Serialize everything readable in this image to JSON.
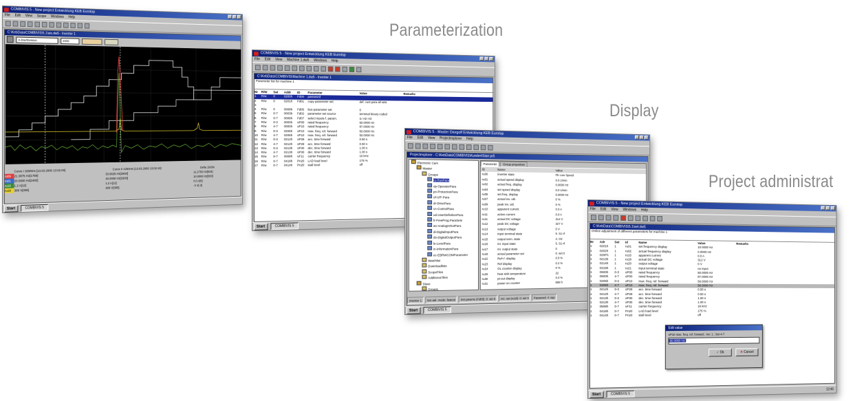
{
  "captions": {
    "parameterization": "Parameterization",
    "display": "Display",
    "project_admin": "Project administrat"
  },
  "scope_window": {
    "title": "COMBIVIS 5 - New project      Entwicklung KEB Eurotop",
    "menus": [
      "File",
      "Edit",
      "View",
      "Scope",
      "Windows",
      "Help"
    ],
    "subtitle": "C:\\KebData\\COMBIVIS\\5.1\\ais.dw5 - Inverter 1",
    "dropdown": "X-line/Division",
    "dropdown2": "2000",
    "status": {
      "curve1": "Curve I 3290ms [13.03.2000 13:02:00]",
      "curve2": "Curve II 4250ms [13.03.2000 13:02:10]",
      "delta": "Delta 1920s",
      "rows": [
        {
          "name": "ru09",
          "a": "21.3875 Hz[1759]",
          "b": "33.6625 Hz[2693]",
          "c": "11.2750 Hz[534]"
        },
        {
          "name": "ru01",
          "a": "20.0000 Hz[2400]",
          "b": "40.0000 Hz[3300]",
          "c": "10.0000 Hz[500]"
        },
        {
          "name": "ru15",
          "a": "1.2 A[12]",
          "b": "1.2 A[12]",
          "c": "0.0 A[0]"
        },
        {
          "name": "ru18",
          "a": "308 V[308]",
          "b": "308 V[385]",
          "c": "-3 V[-3]"
        }
      ]
    },
    "taskbar": {
      "start": "Start",
      "item": "COMBIVIS 5"
    }
  },
  "param_window": {
    "title": "COMBIVIS 5 - New project      Entwicklung KEB Eurotop",
    "menus": [
      "File",
      "Edit",
      "View",
      "Machine 1.dw5",
      "Windows",
      "Help"
    ],
    "subtitle": "C:\\KebData\\COMBIVIS\\Machine 1.dw5 - Inverter 1",
    "desc": "Parameter list for machine 1",
    "headers": [
      "Nr",
      "R/W",
      "Set",
      "Addr",
      "ID",
      "Parameter",
      "Value",
      "Remarks"
    ],
    "rows": [
      [
        "1",
        "R/w",
        "0",
        "0200h",
        "Fd00",
        "password",
        ""
      ],
      [
        "2",
        "R/w",
        "0",
        "0201h",
        "Fd01",
        "copy parameter set",
        "def. cust para all sets"
      ],
      [
        "3",
        "",
        "",
        "",
        "",
        "",
        ""
      ],
      [
        "4",
        "R/w",
        "0",
        "0008h",
        "Fd05",
        "bus parameter set",
        "0"
      ],
      [
        "5",
        "R/w",
        "0-7",
        "0003h",
        "Fd02",
        "parameter set source",
        "terminal binary coded"
      ],
      [
        "6",
        "R/w",
        "0-7",
        "0006h",
        "Fd07",
        "select inputs f. param.",
        "i1->i2->i3"
      ],
      [
        "7",
        "R/w",
        "0-3",
        "0000h",
        "oP00",
        "rated frequency",
        "50.0000 Hz"
      ],
      [
        "8",
        "R/w",
        "4-7",
        "0000h",
        "oP10",
        "rated frequency",
        "87.0000 Hz"
      ],
      [
        "9",
        "R/w",
        "0-3",
        "0206h",
        "oP10",
        "max. freq. ref. forward",
        "50.0000 Hz"
      ],
      [
        "10",
        "R/w",
        "4-7",
        "0206h",
        "oP10",
        "max. freq. ref. forward",
        "50.0000 Hz"
      ],
      [
        "11",
        "R/w",
        "0-3",
        "0212h",
        "oP28",
        "acc. time forward",
        "0.50 s"
      ],
      [
        "12",
        "R/w",
        "4-7",
        "0212h",
        "oP28",
        "acc. time forward",
        "0.50 s"
      ],
      [
        "13",
        "R/w",
        "0-3",
        "0213h",
        "oP30",
        "dec. time forward",
        "1.00 s"
      ],
      [
        "14",
        "R/w",
        "4-7",
        "0213h",
        "oP30",
        "dec. time forward",
        "1.00 s"
      ],
      [
        "15",
        "R/w",
        "0-7",
        "0008h",
        "uF11",
        "carrier frequency",
        "16 kHz"
      ],
      [
        "16",
        "R/w",
        "0-7",
        "0418h",
        "Pn20",
        "LAD load level",
        "175 %"
      ],
      [
        "17",
        "R/w",
        "0-7",
        "0414h",
        "Pn20",
        "stall level",
        "off"
      ]
    ],
    "taskbar": {
      "start": "Start",
      "item": "COMBIVIS 5"
    }
  },
  "display_window": {
    "title": "COMBIVIS 5 - Master Diorgolf      Entwicklung KEB Eurotop",
    "menus": [
      "File",
      "Edit",
      "View",
      "Projectexplorer",
      "Help"
    ],
    "subtitle": "Projectexplorer - C:\\KebData\\COMBIVIS\\Kunden\\Starr.pr5",
    "tree": [
      "Electronic Cam",
      "Master",
      "Groups",
      "ru-RunPara",
      "op-OperatorPara",
      "pn-ProtectionPara",
      "uf-U/F-Para",
      "dr-DrivePara",
      "cn-ControlPara",
      "ud-UserDefinitionPara",
      "fr-FreeProg.ParaSets",
      "an-AnalogInOutPara",
      "di-DigitalInputPara",
      "do-DigitalOutputPara",
      "le-LevelPara",
      "in-InformationPara",
      "ec-EBRWCOMParameter",
      "Watchlist",
      "Downloadlists",
      "ScopeFiles",
      "Additional files",
      "Slave",
      "Groups",
      "Watchlist",
      "Downloadlists",
      "ScopeFiles"
    ],
    "tabs": [
      "Parameter",
      "Group properties"
    ],
    "headers": [
      "ID",
      "Name",
      "Value"
    ],
    "rows": [
      [
        "ru00",
        "inverter state",
        "Fb Low Speed"
      ],
      [
        "ru01",
        "actual speed display",
        "0.0 1/min"
      ],
      [
        "ru02",
        "actual freq. display",
        "0.0000 Hz"
      ],
      [
        "ru04",
        "set speed display",
        "0.0 1/min"
      ],
      [
        "ru05",
        "set freq. display",
        "0.0000 Hz"
      ],
      [
        "ru07",
        "actual inv. util.",
        "0 %"
      ],
      [
        "ru09",
        "peak inv. util.",
        "0 %"
      ],
      [
        "ru10",
        "apparent current",
        "0.0 A"
      ],
      [
        "ru11",
        "active current",
        "0.0 A"
      ],
      [
        "ru11",
        "actual DC voltage",
        "314 V"
      ],
      [
        "ru12",
        "peak DC voltage",
        "327 V"
      ],
      [
        "ru13",
        "output voltage",
        "0 V"
      ],
      [
        "ru14",
        "input terminal state",
        "5. S1-rf"
      ],
      [
        "ru15",
        "output term. state",
        "2. O2"
      ],
      [
        "ru16",
        "int. input state",
        "5. S1-rf"
      ],
      [
        "ru17",
        "int. output state",
        "0"
      ],
      [
        "ru18",
        "actual parameter set",
        "0. set 0"
      ],
      [
        "ru22",
        "Ref+/- display",
        "0.0 %"
      ],
      [
        "ru23",
        "Ref display",
        "0.2 %"
      ],
      [
        "ru24",
        "OL counter display",
        "0 %"
      ],
      [
        "ru26",
        "heat sink temperature",
        "22"
      ],
      [
        "ru30",
        "pt-out display",
        "0.0 %"
      ],
      [
        "ru31",
        "power on counter",
        "568 h"
      ]
    ],
    "statusbar": [
      "Inverter 1",
      "Set adr. mode: fastest",
      "Set params (Fd05): 0: set 0",
      "Act. set (ru18): 0: set 0",
      "Password: 4: sup"
    ],
    "taskbar": {
      "start": "Start",
      "item": "COMBIVIS 5"
    }
  },
  "admin_window": {
    "title": "COMBIVIS 5 - New project      Entwicklung KEB Eurotop",
    "menus": [
      "File",
      "Edit",
      "View",
      "Windows",
      "Help"
    ],
    "subtitle": "C:\\KebData\\COMBIVIS\\5.1\\set.dw5",
    "desc": "Online adjustment of different parameters for machine 1",
    "headers": [
      "Nr",
      "Adr",
      "Set",
      "Id",
      "Name",
      "Value",
      "Remarks"
    ],
    "rows": [
      [
        "1",
        "0201h",
        "1",
        "ru01",
        "set frequency display",
        "10.0000 Hz"
      ],
      [
        "1",
        "0202h",
        "1",
        "ru02",
        "actual frequency display",
        "0.0000 Hz"
      ],
      [
        "1",
        "020Fh",
        "1",
        "ru15",
        "apparent current",
        "0.0 A"
      ],
      [
        "1",
        "0213h",
        "1",
        "ru18",
        "actual DC voltage",
        "312 V"
      ],
      [
        "1",
        "0214h",
        "1",
        "ru20",
        "output voltage",
        "0 V"
      ],
      [
        "1",
        "0219h",
        "1",
        "ru21",
        "input terminal state",
        "no input"
      ],
      [
        "",
        "",
        "",
        "",
        "",
        ""
      ],
      [
        "1",
        "0500h",
        "0-3",
        "oP00",
        "rated frequency",
        "50.0000 Hz"
      ],
      [
        "1",
        "0500h",
        "4-7",
        "oP00",
        "rated frequency",
        "87.0000 Hz"
      ],
      [
        "1",
        "0206h",
        "0-3",
        "oP10",
        "max. freq. ref. forward",
        "50.0000 Hz"
      ],
      [
        "1",
        "0206h",
        "4-7",
        "oP10",
        "max. freq. ref. forward",
        "50.0000 Hz"
      ],
      [
        "1",
        "0212h",
        "0-3",
        "oP28",
        "acc. time forward",
        "0.50 s"
      ],
      [
        "1",
        "0212h",
        "4-7",
        "oP28",
        "acc. time forward",
        "0.50 s"
      ],
      [
        "1",
        "0213h",
        "0-3",
        "oP30",
        "dec. time forward",
        "1.00 s"
      ],
      [
        "1",
        "0213h",
        "4-7",
        "oP30",
        "dec. time forward",
        "1.00 s"
      ],
      [
        "1",
        "0508h",
        "0-7",
        "uF11",
        "carrier frequency",
        "16 kHz"
      ],
      [
        "1",
        "0418h",
        "0-7",
        "Pn20",
        "LAD load level",
        "175 %"
      ],
      [
        "1",
        "0414h",
        "0-7",
        "Pn20",
        "stall level",
        "off"
      ]
    ],
    "dialog": {
      "title": "Edit value",
      "field_label": "oP10 max. freq. ref. forward ; Inv: 1 ; Set 4-7",
      "value": "50.0000 Hz",
      "ok": "Ok",
      "cancel": "Cancel"
    },
    "taskbar": {
      "start": "Start",
      "item": "COMBIVIS 5",
      "clock": "12:45"
    }
  },
  "colors": {
    "titlebar": "#0a1f7a",
    "scope_bg": "#000000",
    "trace_white": "#ffffff",
    "trace_yellow": "#e8d030",
    "trace_green": "#6fbf3a",
    "trace_red": "#e04040"
  }
}
